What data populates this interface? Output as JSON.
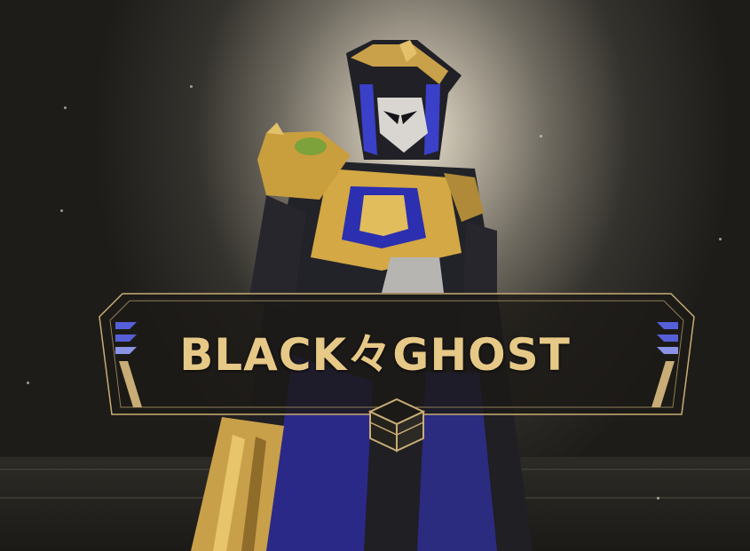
{
  "banner": {
    "title": "BLACK々GHOST"
  },
  "icons": {
    "crate": "crate-icon",
    "left_stripes": "chevron-stripes-icon",
    "right_stripes": "chevron-stripes-icon"
  },
  "colors": {
    "gold": "#e6c887",
    "banner_bg": "#1c1a16",
    "accent_blue": "#5560d8",
    "armor_dark": "#232428"
  }
}
